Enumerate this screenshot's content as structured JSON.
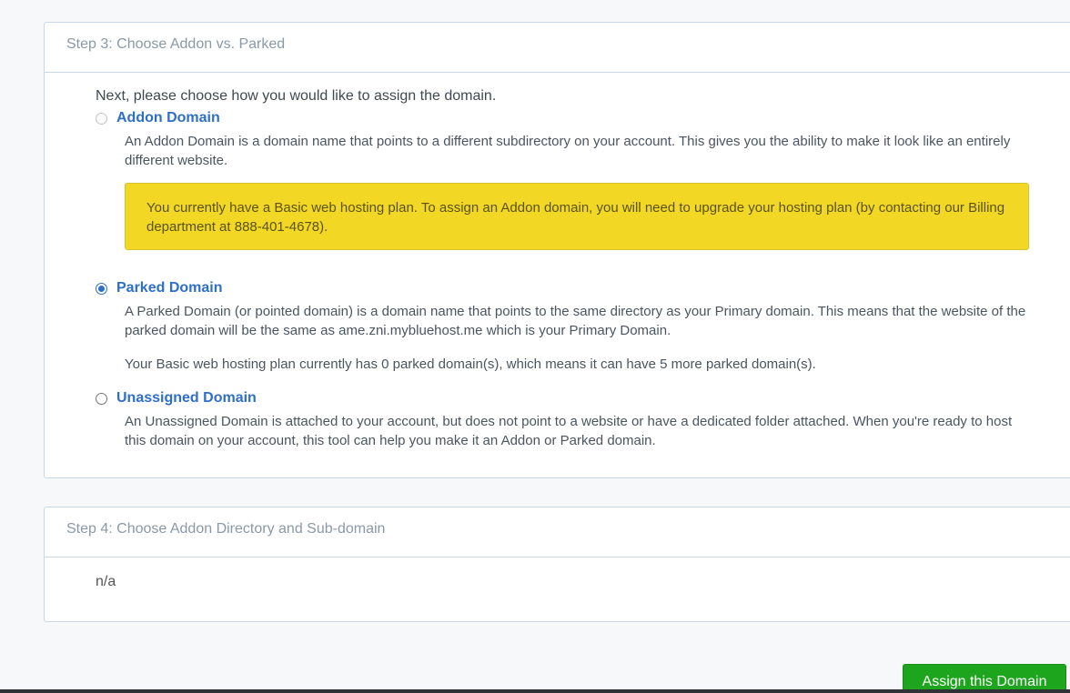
{
  "step3": {
    "title": "Step 3: Choose Addon vs. Parked",
    "intro": "Next, please choose how you would like to assign the domain.",
    "addon": {
      "label": "Addon Domain",
      "description": "An Addon Domain is a domain name that points to a different subdirectory on your account. This gives you the ability to make it look like an entirely different website.",
      "alert": "You currently have a Basic web hosting plan. To assign an Addon domain, you will need to upgrade your hosting plan (by contacting our Billing department at 888-401-4678)."
    },
    "parked": {
      "label": "Parked Domain",
      "description": "A Parked Domain (or pointed domain) is a domain name that points to the same directory as your Primary domain. This means that the website of the parked domain will be the same as ame.zni.mybluehost.me which is your Primary Domain.",
      "plan_note": "Your Basic web hosting plan currently has 0 parked domain(s), which means it can have 5 more parked domain(s)."
    },
    "unassigned": {
      "label": "Unassigned Domain",
      "description": "An Unassigned Domain is attached to your account, but does not point to a website or have a dedicated folder attached. When you're ready to host this domain on your account, this tool can help you make it an Addon or Parked domain."
    }
  },
  "step4": {
    "title": "Step 4: Choose Addon Directory and Sub-domain",
    "value": "n/a"
  },
  "actions": {
    "assign_label": "Assign this Domain"
  },
  "colors": {
    "link_blue": "#2e6fc7",
    "alert_yellow": "#f2d824",
    "button_green": "#1ea51e"
  }
}
